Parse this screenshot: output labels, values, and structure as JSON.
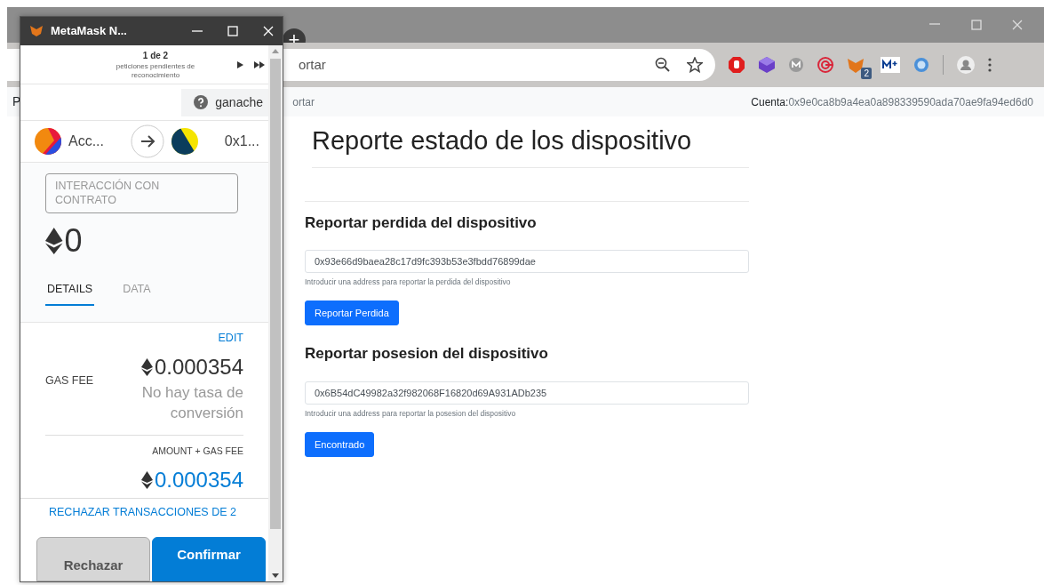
{
  "browser": {
    "new_tab": "+",
    "address_text": "ortar",
    "extension_badge": "2",
    "nav": {
      "brand": "P",
      "link": "ortar",
      "account_label": "Cuenta:",
      "account": "0x9e0ca8b9a4ea0a898339590ada70ae9fa94ed6d0"
    }
  },
  "page": {
    "title": "Reporte estado de los dispositivo",
    "sections": [
      {
        "heading": "Reportar perdida del dispositivo",
        "value": "0x93e66d9baea28c17d9fc393b53e3fbdd76899dae",
        "help": "Introducir una address para reportar la perdida del dispositivo",
        "button": "Reportar Perdida"
      },
      {
        "heading": "Reportar posesion del dispositivo",
        "value": "0x6B54dC49982a32f982068F16820d69A931ADb235",
        "help": "Introducir una address para reportar la posesion del dispositivo",
        "button": "Encontrado"
      }
    ]
  },
  "metamask": {
    "title": "MetaMask N...",
    "pager": {
      "count": "1 de 2",
      "caption": "peticiones pendientes de reconocimiento"
    },
    "network": "ganache",
    "from": "Acc...",
    "to": "0x1...",
    "method": "INTERACCIÓN CON CONTRATO",
    "amount": "0",
    "tabs": [
      {
        "label": "DETAILS",
        "selected": true
      },
      {
        "label": "DATA",
        "selected": false
      }
    ],
    "edit": "EDIT",
    "gas_fee_label": "GAS FEE",
    "gas_fee": "0.000354",
    "conversion": "No hay tasa de conversión",
    "total_label": "AMOUNT + GAS FEE",
    "total": "0.000354",
    "reject_all": "RECHAZAR TRANSACCIONES DE 2",
    "buttons": [
      {
        "kind": "reject",
        "label": "Rechazar"
      },
      {
        "kind": "confirm",
        "label": "Confirmar"
      }
    ]
  }
}
